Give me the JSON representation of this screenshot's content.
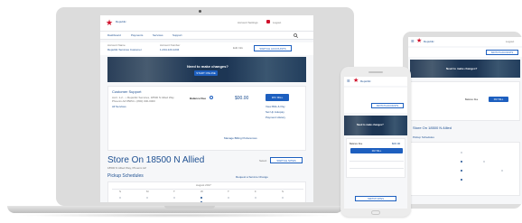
{
  "app": {
    "brand_color": "#d0112b",
    "primary_color": "#1d4f91",
    "button_color": "#1d5fbf",
    "logo_icon": "star-icon"
  },
  "laptop": {
    "header": {
      "logo_text": "Republic",
      "account_link": "Account Settings",
      "logout_link": "Logout"
    },
    "nav": {
      "items": [
        "Dashboard",
        "Payments",
        "Services",
        "Support"
      ],
      "search_icon": "search-icon"
    },
    "account_bar": {
      "account_name_label": "Account Name",
      "account_name_value": "Republic Services Customer",
      "account_number_label": "Account Number",
      "account_number_value": "1-234-123-1234",
      "link": "Edit Info",
      "button": "SWITCH ACCOUNTS"
    },
    "banner": {
      "title": "Need to make changes?",
      "button": "START ONLINE"
    },
    "billing": {
      "heading": "Customer Support",
      "address": "Acct. 1-2... • Republic Services, 18500 N Allied Way",
      "details": "Phoenix AZ 85054 • (800) 000-0000",
      "link": "All Services",
      "balance_label": "Balance Due",
      "amount": "$00.00",
      "pay_button": "PAY BILL",
      "link_1": "View Bills & Pay",
      "link_2": "Set Up Autopay",
      "link_3": "Payment History",
      "link_4": "Manage Billing Preferences"
    },
    "store": {
      "title": "Store On 18500 N Allied",
      "subtitle": "18500 N Allied Way, Phoenix AZ",
      "select_label": "Select",
      "select_button": "SWITCH SITES",
      "schedule_title": "Pickup Schedules",
      "schedule_link": "Request a Service Change",
      "calendar_month": "August 2017",
      "weekdays": [
        "S",
        "M",
        "T",
        "W",
        "T",
        "F",
        "S"
      ]
    }
  },
  "tablet": {
    "header": {
      "logo_text": "Republic",
      "logout_link": "Logout"
    },
    "account_bar": {
      "button": "SWITCH ACCOUNTS"
    },
    "banner": {
      "title": "Need to make changes?"
    },
    "billing": {
      "pay_button": "PAY BILL",
      "balance_label": "Balance Due"
    },
    "store": {
      "title": "Store On 18500 N Allied",
      "schedule_title": "Pickup Schedules"
    }
  },
  "phone": {
    "header": {
      "logo_text": "Republic"
    },
    "account_bar": {
      "button": "SWITCH ACCOUNTS"
    },
    "banner": {
      "title": "Need to make changes?"
    },
    "billing": {
      "pay_button": "PAY BILL",
      "balance_label": "Balance Due",
      "amount": "$00.00"
    },
    "store": {
      "select_button": "SWITCH SITES"
    }
  }
}
